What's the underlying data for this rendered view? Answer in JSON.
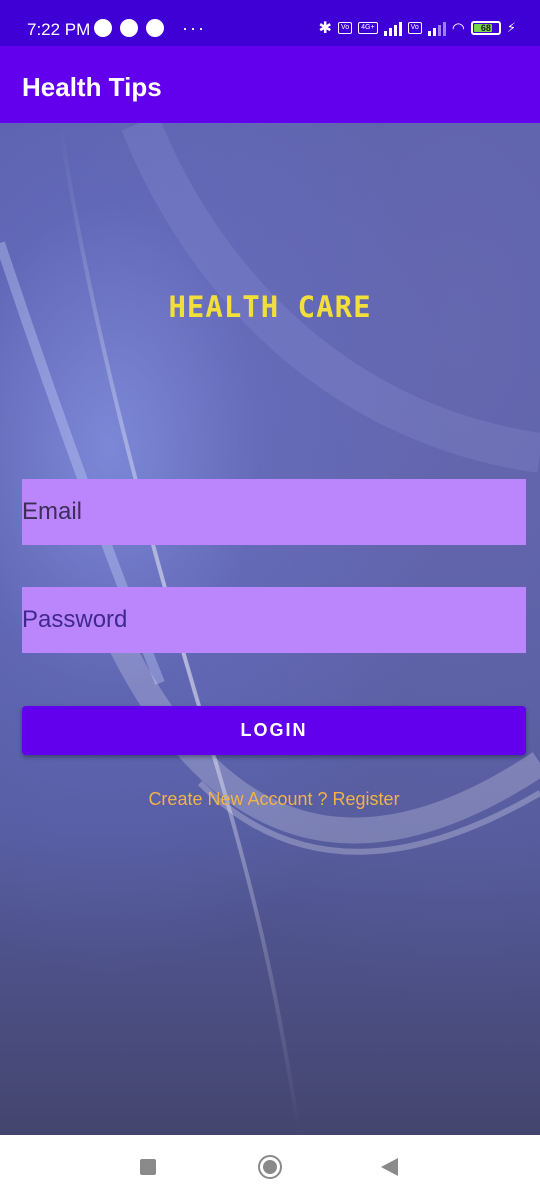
{
  "status_bar": {
    "time": "7:22 PM",
    "battery_level": "68",
    "network": "4G+"
  },
  "app_bar": {
    "title": "Health Tips"
  },
  "login_screen": {
    "heading": "HEALTH CARE",
    "email_placeholder": "Email",
    "password_placeholder": "Password",
    "login_label": "LOGIN",
    "register_link": "Create New Account ? Register"
  },
  "colors": {
    "status_bar": "#3f00d6",
    "app_bar": "#6200ee",
    "field_background": "#bb86fc",
    "button": "#6200ee",
    "heading": "#f2df3a",
    "register_link": "#f0b347"
  },
  "nav_bar": {
    "icons": [
      "recents-square-icon",
      "home-circle-icon",
      "back-triangle-icon"
    ]
  }
}
